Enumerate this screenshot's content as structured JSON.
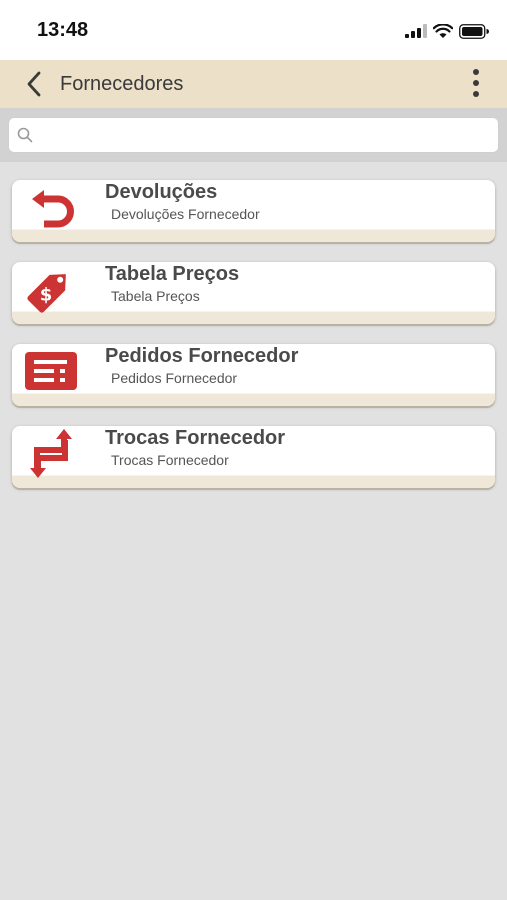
{
  "status": {
    "time": "13:48"
  },
  "nav": {
    "title": "Fornecedores"
  },
  "search": {
    "placeholder": "",
    "value": ""
  },
  "colors": {
    "accent": "#cc3333",
    "navbar": "#ece0c8",
    "background": "#e1e1e1"
  },
  "items": [
    {
      "title": "Devoluções",
      "subtitle": "Devoluções Fornecedor",
      "icon": "return-arrow-icon"
    },
    {
      "title": "Tabela Preços",
      "subtitle": "Tabela Preços",
      "icon": "price-tag-icon"
    },
    {
      "title": "Pedidos Fornecedor",
      "subtitle": "Pedidos Fornecedor",
      "icon": "order-list-icon"
    },
    {
      "title": "Trocas Fornecedor",
      "subtitle": "Trocas Fornecedor",
      "icon": "exchange-arrows-icon"
    }
  ]
}
